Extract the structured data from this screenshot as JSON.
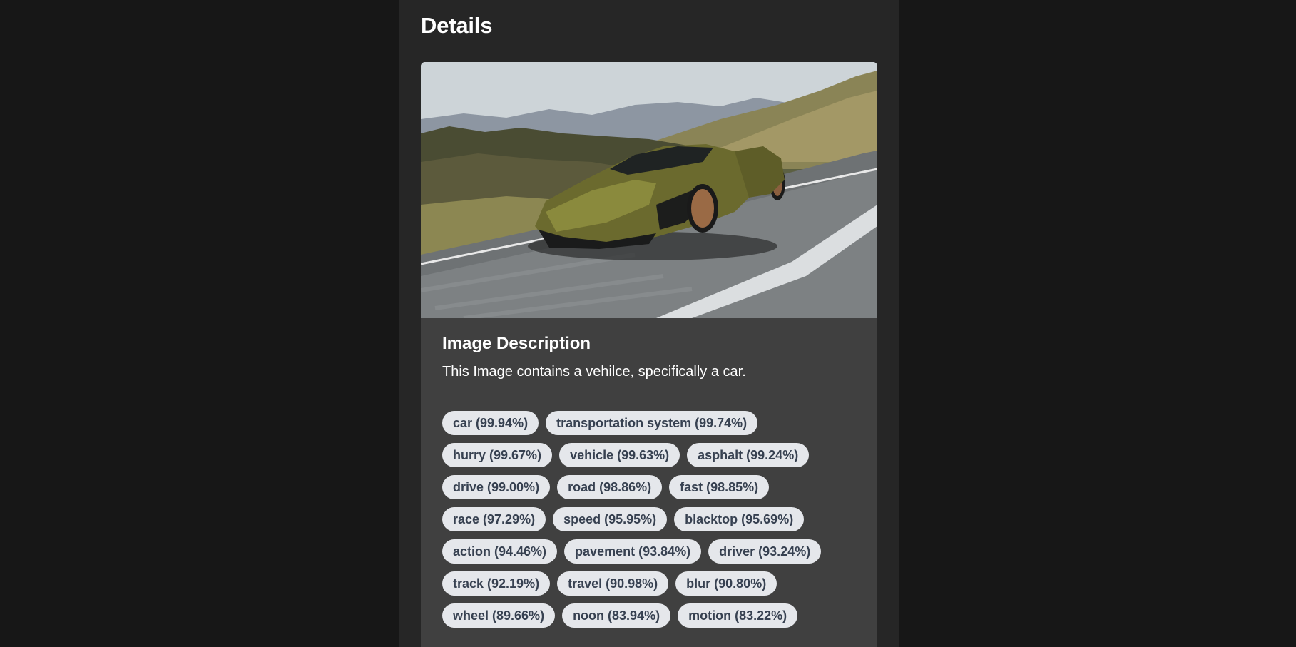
{
  "page": {
    "title": "Details"
  },
  "card": {
    "image_alt": "Image of a car",
    "description_title": "Image Description",
    "description_text": "This Image contains a vehilce, specifically a car."
  },
  "tags": [
    "car (99.94%)",
    "transportation system (99.74%)",
    "hurry (99.67%)",
    "vehicle (99.63%)",
    "asphalt (99.24%)",
    "drive (99.00%)",
    "road (98.86%)",
    "fast (98.85%)",
    "race (97.29%)",
    "speed (95.95%)",
    "blacktop (95.69%)",
    "action (94.46%)",
    "pavement (93.84%)",
    "driver (93.24%)",
    "track (92.19%)",
    "travel (90.98%)",
    "blur (90.80%)",
    "wheel (89.66%)",
    "noon (83.94%)",
    "motion (83.22%)"
  ],
  "colors": {
    "page_bg": "#171717",
    "column_bg": "#262626",
    "card_bg": "#404040",
    "tag_bg": "#e5e7eb",
    "tag_text": "#374151"
  }
}
